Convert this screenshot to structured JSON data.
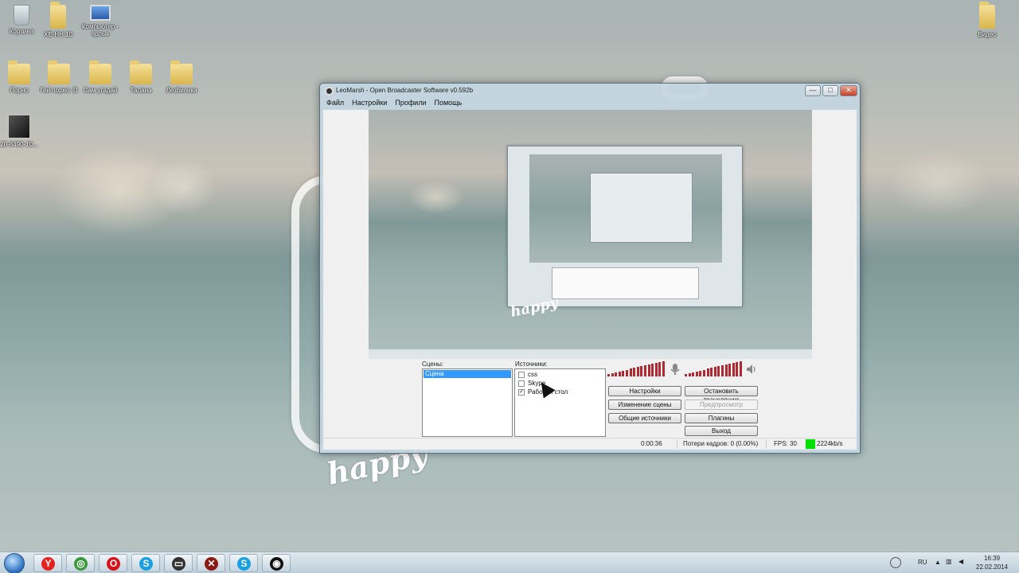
{
  "desktop": {
    "icons": [
      {
        "label": "Корзина",
        "kind": "bin"
      },
      {
        "label": "ХЕ-НН 10",
        "kind": "folder"
      },
      {
        "label": "Компьютер - ярлык",
        "kind": "pc"
      },
      {
        "label": "Видео",
        "kind": "folder"
      },
      {
        "label": "Порно",
        "kind": "folder"
      },
      {
        "label": "Гей порно :D",
        "kind": "folder"
      },
      {
        "label": "Сам угадай",
        "kind": "folder"
      },
      {
        "label": "Талана",
        "kind": "folder"
      },
      {
        "label": "Лезбиянки",
        "kind": "folder"
      },
      {
        "label": "20-8490-10...",
        "kind": "photo"
      }
    ],
    "wallpaper_text": "happy"
  },
  "window": {
    "title": "LeoMarsh - Open Broadcaster Software v0.592b",
    "controls": {
      "minimize": "—",
      "maximize": "□",
      "close": "✕"
    },
    "menu": [
      "Файл",
      "Настройки",
      "Профили",
      "Помощь"
    ],
    "scenes_label": "Сцены:",
    "scenes": [
      {
        "name": "Сцена",
        "selected": true
      }
    ],
    "sources_label": "Источники:",
    "sources": [
      {
        "name": "css",
        "checked": false
      },
      {
        "name": "Skype",
        "checked": false
      },
      {
        "name": "Рабочий стол",
        "checked": true
      }
    ],
    "buttons": {
      "settings": "Настройки",
      "stop_stream": "Остановить трансляцию",
      "edit_scene": "Изменение сцены",
      "preview": "Предпросмотр",
      "global_sources": "Общие источники",
      "plugins": "Плагины",
      "exit": "Выход"
    },
    "status": {
      "time": "0:00:36",
      "dropped_frames": "Потери кадров: 0 (0.00%)",
      "fps": "FPS: 30",
      "bitrate": "2224kb/s",
      "bitrate_color": "#00e000"
    }
  },
  "taskbar": {
    "apps": [
      {
        "name": "yandex-browser",
        "glyph": "Y",
        "color": "#e52222"
      },
      {
        "name": "chrome",
        "glyph": "◎",
        "color": "#3a9a3a"
      },
      {
        "name": "opera",
        "glyph": "O",
        "color": "#d8121b"
      },
      {
        "name": "skype",
        "glyph": "S",
        "color": "#1aa0e0"
      },
      {
        "name": "terminal",
        "glyph": "▭",
        "color": "#333333"
      },
      {
        "name": "dota",
        "glyph": "✕",
        "color": "#8a1a12"
      },
      {
        "name": "skype-2",
        "glyph": "S",
        "color": "#1aa0e0"
      },
      {
        "name": "obs",
        "glyph": "◉",
        "color": "#111111"
      }
    ],
    "language": "RU",
    "time": "16:39",
    "date": "22.02.2014"
  }
}
